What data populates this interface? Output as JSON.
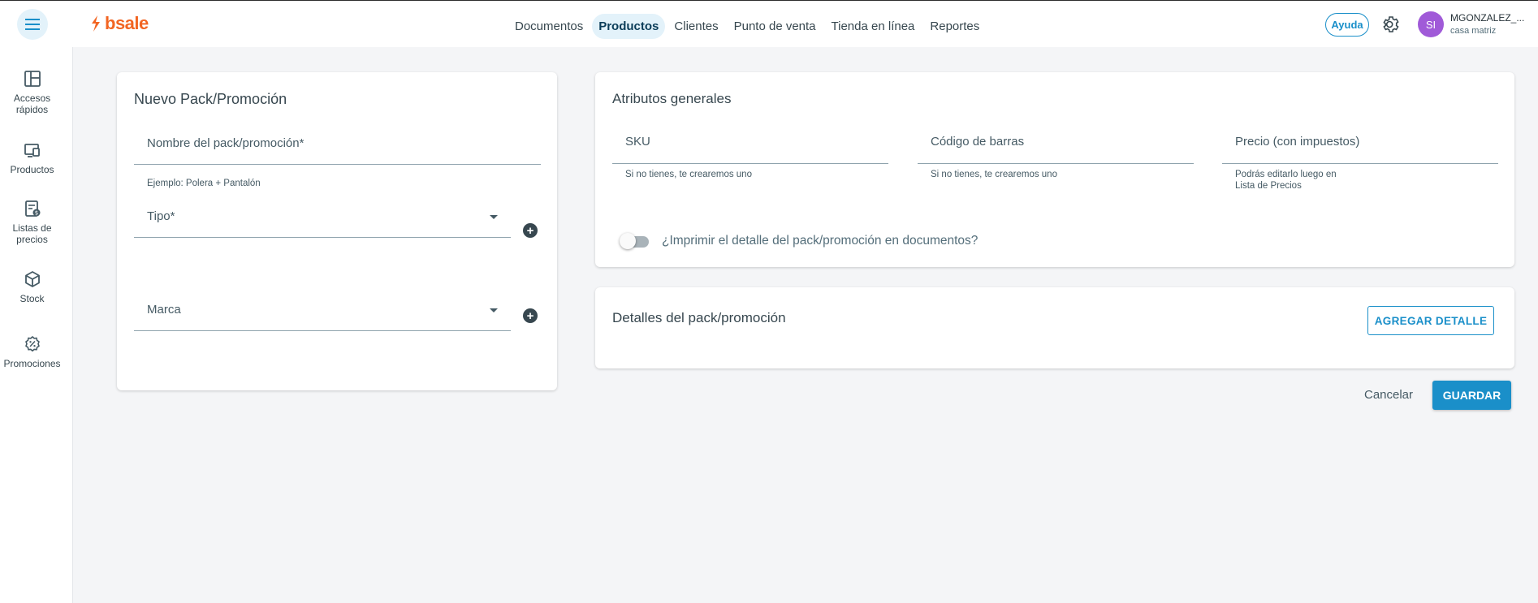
{
  "topbar": {
    "logo_text": "bsale",
    "nav": [
      {
        "label": "Documentos",
        "active": false
      },
      {
        "label": "Productos",
        "active": true
      },
      {
        "label": "Clientes",
        "active": false
      },
      {
        "label": "Punto de venta",
        "active": false
      },
      {
        "label": "Tienda en línea",
        "active": false
      },
      {
        "label": "Reportes",
        "active": false
      }
    ],
    "help_label": "Ayuda",
    "avatar_initials": "SI",
    "user_name": "MGONZALEZ_...",
    "user_branch": "casa matriz"
  },
  "sidebar": {
    "items": [
      {
        "label_line1": "Accesos",
        "label_line2": "rápidos",
        "icon": "dashboard-icon"
      },
      {
        "label_line1": "Productos",
        "label_line2": "",
        "icon": "products-icon"
      },
      {
        "label_line1": "Listas de",
        "label_line2": "precios",
        "icon": "price-list-icon"
      },
      {
        "label_line1": "Stock",
        "label_line2": "",
        "icon": "stock-box-icon"
      },
      {
        "label_line1": "Promociones",
        "label_line2": "",
        "icon": "promotion-icon"
      }
    ]
  },
  "pack_card": {
    "title": "Nuevo Pack/Promoción",
    "name_label": "Nombre del pack/promoción*",
    "name_helper": "Ejemplo: Polera + Pantalón",
    "type_label": "Tipo*",
    "brand_label": "Marca"
  },
  "attributes_card": {
    "title": "Atributos generales",
    "sku_label": "SKU",
    "sku_helper": "Si no tienes, te crearemos uno",
    "barcode_label": "Código de barras",
    "barcode_helper": "Si no tienes, te crearemos uno",
    "price_label": "Precio (con impuestos)",
    "price_helper_line1": "Podrás editarlo luego en",
    "price_helper_line2": "Lista de Precios",
    "print_toggle_label": "¿Imprimir el detalle del pack/promoción en documentos?",
    "print_toggle_on": false
  },
  "details_card": {
    "title": "Detalles del pack/promoción",
    "add_detail_label": "AGREGAR DETALLE"
  },
  "actions": {
    "cancel_label": "Cancelar",
    "save_label": "GUARDAR"
  },
  "colors": {
    "brand_orange": "#f26522",
    "primary_blue": "#1a8fc9",
    "active_nav_bg": "#e3f2fa",
    "avatar_purple": "#a05ad8"
  }
}
